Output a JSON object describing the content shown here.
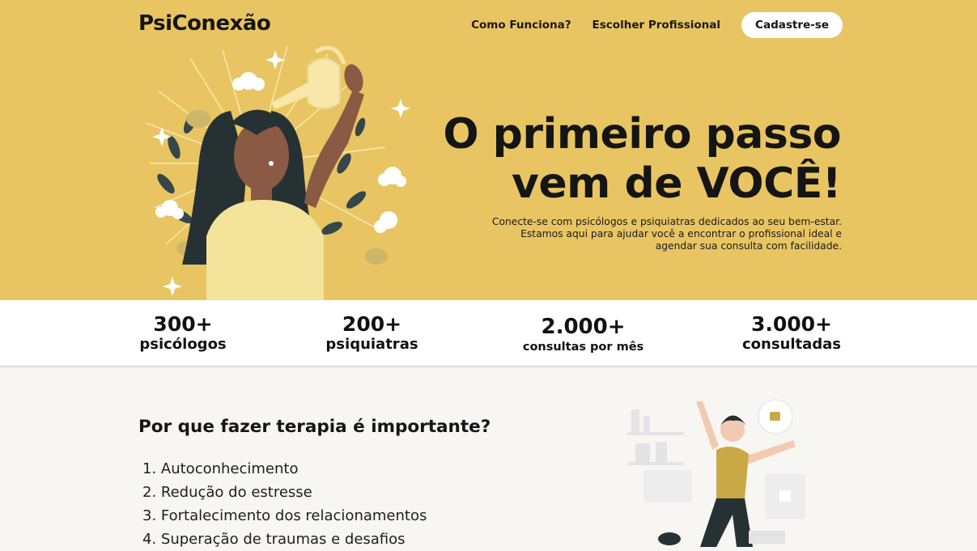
{
  "header": {
    "logo": "PsiConexão",
    "nav": [
      "Como Funciona?",
      "Escolher Profissional"
    ],
    "cta": "Cadastre-se"
  },
  "hero": {
    "headline_line1": "O primeiro passo",
    "headline_line2": "vem de VOCÊ!",
    "description_lines": [
      "Conecte-se com psicólogos e psiquiatras dedicados ao seu bem-estar.",
      "Estamos aqui para ajudar você a encontrar o profissional ideal e",
      "agendar sua consulta com facilidade."
    ]
  },
  "stats": [
    {
      "value": "300+",
      "label": "psicólogos"
    },
    {
      "value": "200+",
      "label": "psiquiatras"
    },
    {
      "value": "2.000+",
      "label": "consultas por mês"
    },
    {
      "value": "3.000+",
      "label": "consultadas"
    }
  ],
  "why": {
    "title": "Por que fazer terapia é importante?",
    "items": [
      "1. Autoconhecimento",
      "2. Redução do estresse",
      "3. Fortalecimento dos relacionamentos",
      "4. Superação de traumas e desafios"
    ]
  },
  "colors": {
    "hero_bg": "#e8c562",
    "section_bg": "#f8f6f2",
    "accent": "#c9a945"
  }
}
